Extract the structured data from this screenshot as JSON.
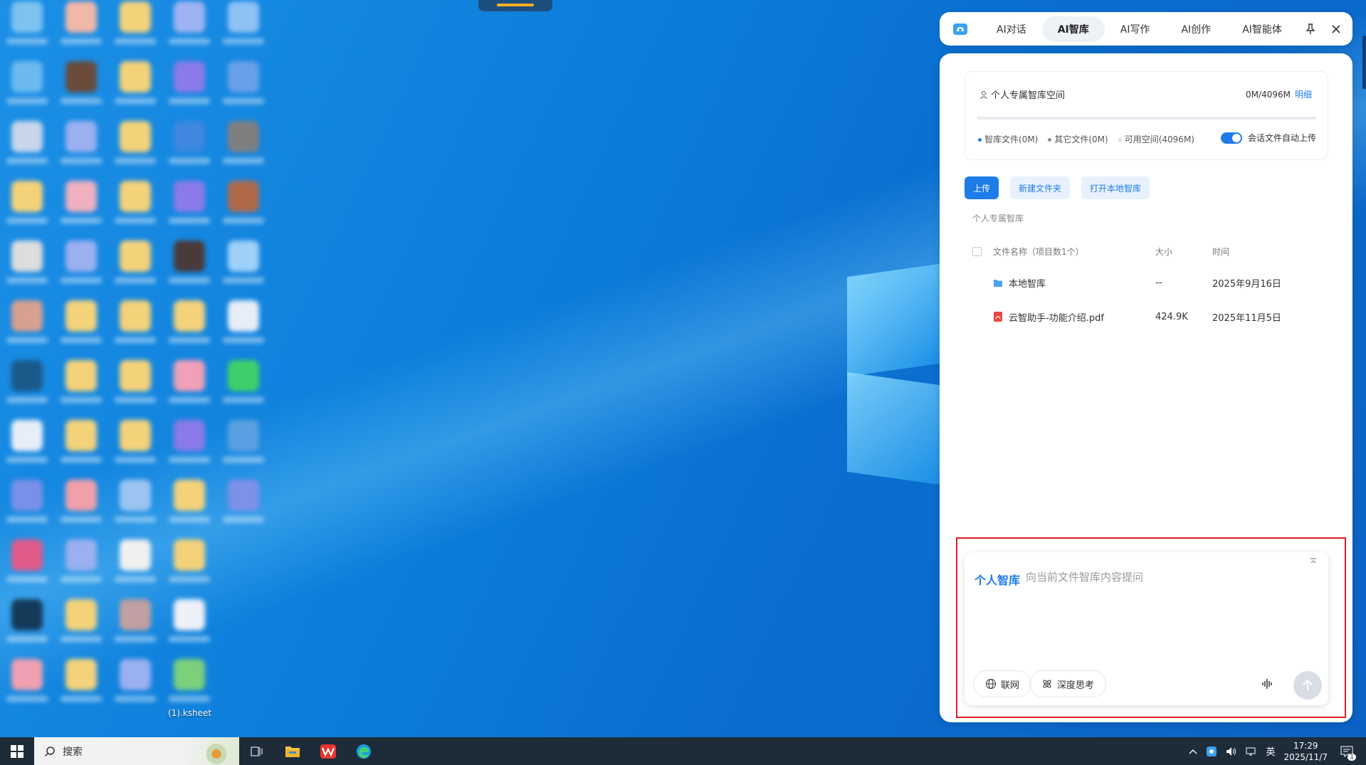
{
  "desktop": {
    "file_label": "(1).ksheet"
  },
  "ai_tabs": {
    "items": [
      {
        "label": "AI对话",
        "active": false
      },
      {
        "label": "AI智库",
        "active": true
      },
      {
        "label": "AI写作",
        "active": false
      },
      {
        "label": "AI创作",
        "active": false
      },
      {
        "label": "AI智能体",
        "active": false
      }
    ]
  },
  "storage": {
    "title": "个人专属智库空间",
    "usage": "0M/4096M",
    "detail_link": "明细",
    "used_fraction": 0.0,
    "legend": [
      {
        "label": "智库文件(0M)",
        "color": "#1e7ce8"
      },
      {
        "label": "其它文件(0M)",
        "color": "#8a8f99"
      },
      {
        "label": "可用空间(4096M)",
        "color": "#d9dce2"
      }
    ],
    "auto_upload_label": "会话文件自动上传",
    "auto_upload_on": true
  },
  "actions": {
    "upload": "上传",
    "new_folder": "新建文件夹",
    "open_local": "打开本地智库"
  },
  "breadcrumb": "个人专属智库",
  "file_table": {
    "headers": {
      "name": "文件名称（项目数1个）",
      "size": "大小",
      "time": "时间"
    },
    "rows": [
      {
        "name": "本地智库",
        "size": "--",
        "time": "2025年9月16日",
        "icon": "folder-icon"
      },
      {
        "name": "云智助手-功能介绍.pdf",
        "size": "424.9K",
        "time": "2025年11月5日",
        "icon": "pdf-icon"
      }
    ]
  },
  "composer": {
    "tag": "个人智库",
    "placeholder": "向当前文件智库内容提问",
    "web_label": "联网",
    "deep_label": "深度思考"
  },
  "taskbar": {
    "search_label": "搜索",
    "ime": "英",
    "time": "17:29",
    "date": "2025/11/7",
    "notification_count": "1"
  }
}
